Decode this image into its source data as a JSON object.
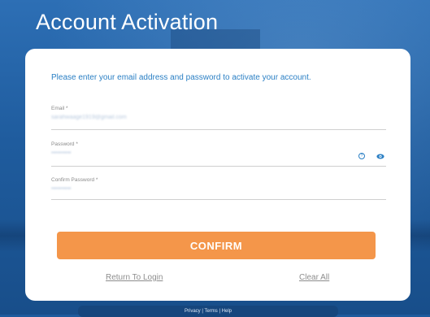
{
  "page": {
    "title": "Account Activation"
  },
  "form": {
    "intro": "Please enter your email address and password to activate your account.",
    "email": {
      "label": "Email *",
      "value": "sarahwaage1919@gmail.com"
    },
    "password": {
      "label": "Password *",
      "value": "••••••••••"
    },
    "confirm_password": {
      "label": "Confirm Password *",
      "value": "••••••••••"
    },
    "confirm_button": "CONFIRM",
    "return_link": "Return To Login",
    "clear_link": "Clear All"
  },
  "footer": {
    "text": "Privacy | Terms | Help"
  },
  "colors": {
    "accent": "#2a7fc4",
    "button": "#f4964a",
    "background": "#1f5c9e"
  },
  "icons": {
    "help": "help-circle-icon",
    "visibility": "eye-icon"
  }
}
